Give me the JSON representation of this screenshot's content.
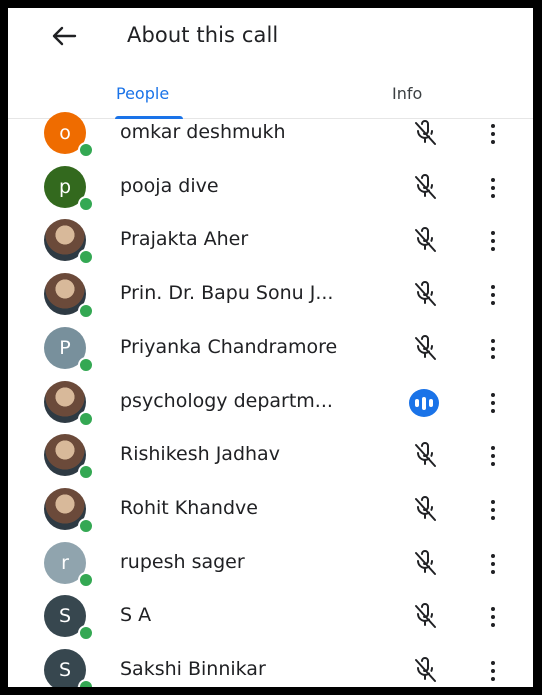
{
  "header": {
    "title": "About this call",
    "back_icon": "arrow-back-icon"
  },
  "tabs": [
    {
      "label": "People",
      "active": true
    },
    {
      "label": "Info",
      "active": false
    }
  ],
  "colors": {
    "accent": "#1a73e8",
    "online": "#34a853"
  },
  "participants": [
    {
      "name": "omkar deshmukh",
      "initial": "o",
      "avatar_color": "#ef6c00",
      "mic": "muted"
    },
    {
      "name": "pooja dive",
      "initial": "p",
      "avatar_color": "#33691e",
      "mic": "muted"
    },
    {
      "name": "Prajakta Aher",
      "initial": "",
      "avatar_color": "",
      "mic": "muted"
    },
    {
      "name": "Prin. Dr. Bapu Sonu J...",
      "initial": "",
      "avatar_color": "",
      "mic": "muted"
    },
    {
      "name": "Priyanka Chandramore",
      "initial": "P",
      "avatar_color": "#78909c",
      "mic": "muted"
    },
    {
      "name": "psychology departm...",
      "initial": "",
      "avatar_color": "",
      "mic": "speaking"
    },
    {
      "name": "Rishikesh Jadhav",
      "initial": "",
      "avatar_color": "",
      "mic": "muted"
    },
    {
      "name": "Rohit Khandve",
      "initial": "",
      "avatar_color": "",
      "mic": "muted"
    },
    {
      "name": "rupesh sager",
      "initial": "r",
      "avatar_color": "#90a4ae",
      "mic": "muted"
    },
    {
      "name": "S A",
      "initial": "S",
      "avatar_color": "#37474f",
      "mic": "muted"
    },
    {
      "name": "Sakshi Binnikar",
      "initial": "S",
      "avatar_color": "#37474f",
      "mic": "muted"
    }
  ]
}
